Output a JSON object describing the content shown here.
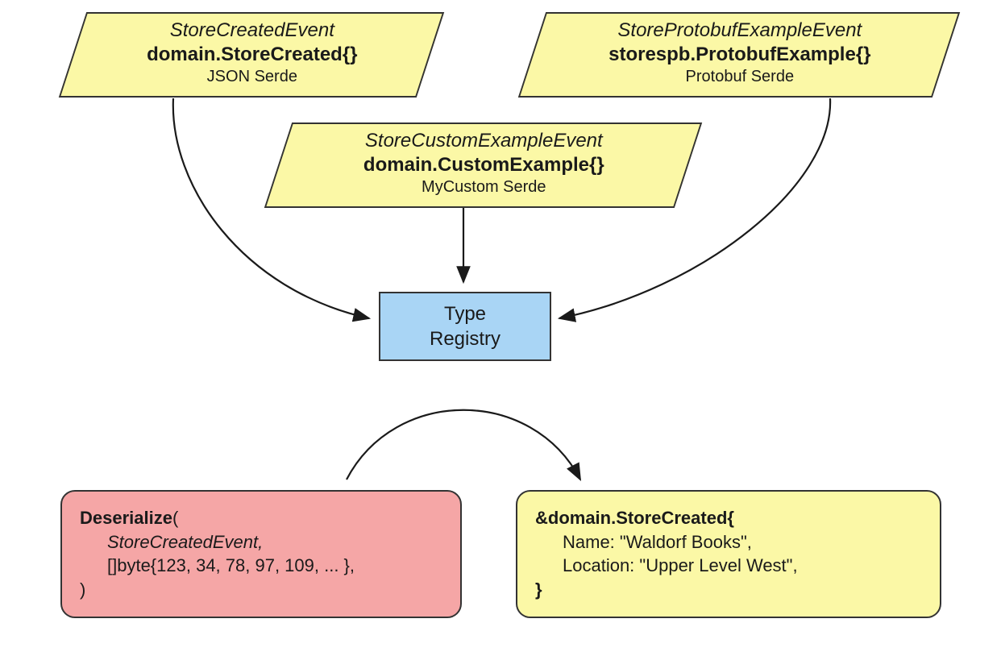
{
  "boxes": {
    "json": {
      "title": "StoreCreatedEvent",
      "type": "domain.StoreCreated{}",
      "serde": "JSON Serde"
    },
    "proto": {
      "title": "StoreProtobufExampleEvent",
      "type": "storespb.ProtobufExample{}",
      "serde": "Protobuf Serde"
    },
    "custom": {
      "title": "StoreCustomExampleEvent",
      "type": "domain.CustomExample{}",
      "serde": "MyCustom Serde"
    }
  },
  "registry": {
    "line1": "Type",
    "line2": "Registry"
  },
  "deserialize": {
    "call": "Deserialize",
    "paren_open": "(",
    "arg1": "StoreCreatedEvent,",
    "arg2": "[]byte{123, 34, 78, 97, 109, ... },",
    "paren_close": ")"
  },
  "result": {
    "head": "&domain.StoreCreated{",
    "name_line": "Name: \"Waldorf Books\",",
    "loc_line": "Location: \"Upper Level West\",",
    "close": "}"
  }
}
